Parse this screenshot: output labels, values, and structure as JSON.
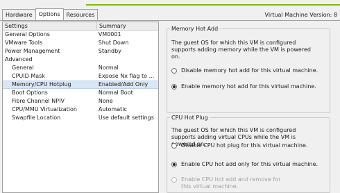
{
  "tabs": [
    "Hardware",
    "Options",
    "Resources"
  ],
  "version_label": "Virtual Machine Version: 8",
  "table": {
    "headers": [
      "Settings",
      "Summary"
    ],
    "rows": [
      {
        "setting": "General Options",
        "summary": "VM0001"
      },
      {
        "setting": "VMware Tools",
        "summary": "Shut Down"
      },
      {
        "setting": "Power Management",
        "summary": "Standby"
      },
      {
        "setting": "Advanced",
        "summary": ""
      },
      {
        "setting": "General",
        "summary": "Normal"
      },
      {
        "setting": "CPUID Mask",
        "summary": "Expose Nx flag to ..."
      },
      {
        "setting": "Memory/CPU Hotplug",
        "summary": "Enabled/Add Only"
      },
      {
        "setting": "Boot Options",
        "summary": "Normal Boot"
      },
      {
        "setting": "Fibre Channel NPIV",
        "summary": "None"
      },
      {
        "setting": "CPU/MMU Virtualization",
        "summary": "Automatic"
      },
      {
        "setting": "Swapfile Location",
        "summary": "Use default settings"
      }
    ]
  },
  "memory_hot_add": {
    "title": "Memory Hot Add",
    "description": "The guest OS for which this VM is configured supports adding memory while the VM is powered on.",
    "options": [
      {
        "label": "Disable memory hot add for this virtual machine.",
        "selected": false
      },
      {
        "label": "Enable memory hot add for this virtual machine.",
        "selected": true
      }
    ]
  },
  "cpu_hot_plug": {
    "title": "CPU Hot Plug",
    "description": "The guest OS for which this VM is configured supports adding virtual CPUs while the VM is powered on.",
    "options": [
      {
        "label": "Disable CPU hot plug for this virtual machine.",
        "selected": false
      },
      {
        "label": "Enable CPU hot add only for this virtual machine.",
        "selected": true
      },
      {
        "label": "Enable CPU hot add and remove for this virtual machine.",
        "selected": false,
        "disabled": true
      }
    ]
  }
}
